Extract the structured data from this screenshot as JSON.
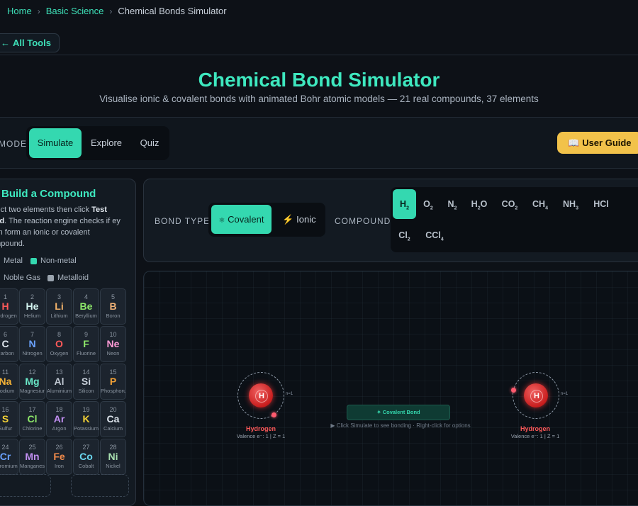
{
  "breadcrumb": {
    "home": "Home",
    "section": "Basic Science",
    "current": "Chemical Bonds Simulator",
    "sep": "›"
  },
  "back_button": {
    "label": "All Tools",
    "icon": "arrow-left-icon"
  },
  "header": {
    "title": "Chemical Bond Simulator",
    "subtitle": "Visualise ionic & covalent bonds with animated Bohr atomic models — 21 real compounds, 37 elements"
  },
  "mode": {
    "label": "MODE",
    "tabs": [
      {
        "label": "Simulate",
        "active": true
      },
      {
        "label": "Explore",
        "active": false
      },
      {
        "label": "Quiz",
        "active": false
      }
    ]
  },
  "user_guide": {
    "label": "User Guide",
    "icon": "book-icon"
  },
  "builder": {
    "title": "Build a Compound",
    "title_icon": "sparkle-icon",
    "desc_pre": "elect two elements then click ",
    "desc_bold1": "Test",
    "desc_bold2": "ond",
    "desc_post": ". The reaction engine checks if ey can form an ionic or covalent ompound.",
    "legend": [
      {
        "label": "Metal",
        "color": "#e0646a"
      },
      {
        "label": "Non-metal",
        "color": "#34d8b0"
      },
      {
        "label": "Noble Gas",
        "color": "#a77ee0"
      },
      {
        "label": "Metalloid",
        "color": "#9aa4ae"
      }
    ],
    "elements": [
      {
        "num": "1",
        "sym": "H",
        "name": "Hydrogen",
        "color": "#ff5a5a"
      },
      {
        "num": "2",
        "sym": "He",
        "name": "Helium",
        "color": "#d4f5f0"
      },
      {
        "num": "3",
        "sym": "Li",
        "name": "Lithium",
        "color": "#f4b36a"
      },
      {
        "num": "4",
        "sym": "Be",
        "name": "Beryllium",
        "color": "#8ee86a"
      },
      {
        "num": "5",
        "sym": "B",
        "name": "Boron",
        "color": "#f0b277"
      },
      {
        "num": "6",
        "sym": "C",
        "name": "Carbon",
        "color": "#dfe6ee"
      },
      {
        "num": "7",
        "sym": "N",
        "name": "Nitrogen",
        "color": "#6aa2ff"
      },
      {
        "num": "8",
        "sym": "O",
        "name": "Oxygen",
        "color": "#ff5a5a"
      },
      {
        "num": "9",
        "sym": "F",
        "name": "Fluorine",
        "color": "#8ee86a"
      },
      {
        "num": "10",
        "sym": "Ne",
        "name": "Neon",
        "color": "#ff9bd6"
      },
      {
        "num": "11",
        "sym": "Na",
        "name": "Sodium",
        "color": "#f4b236"
      },
      {
        "num": "12",
        "sym": "Mg",
        "name": "Magnesium",
        "color": "#6ae8c8"
      },
      {
        "num": "13",
        "sym": "Al",
        "name": "Aluminium",
        "color": "#c0c8d2"
      },
      {
        "num": "14",
        "sym": "Si",
        "name": "Silicon",
        "color": "#c8d0da"
      },
      {
        "num": "15",
        "sym": "P",
        "name": "Phosphorus",
        "color": "#f4a236"
      },
      {
        "num": "16",
        "sym": "S",
        "name": "Sulfur",
        "color": "#f4d236"
      },
      {
        "num": "17",
        "sym": "Cl",
        "name": "Chlorine",
        "color": "#8ee86a"
      },
      {
        "num": "18",
        "sym": "Ar",
        "name": "Argon",
        "color": "#c08ef0"
      },
      {
        "num": "19",
        "sym": "K",
        "name": "Potassium",
        "color": "#f4d236"
      },
      {
        "num": "20",
        "sym": "Ca",
        "name": "Calcium",
        "color": "#dfe6ee"
      },
      {
        "num": "24",
        "sym": "Cr",
        "name": "Chromium",
        "color": "#6aa2ff"
      },
      {
        "num": "25",
        "sym": "Mn",
        "name": "Manganese",
        "color": "#c08ef0"
      },
      {
        "num": "26",
        "sym": "Fe",
        "name": "Iron",
        "color": "#f08a4a"
      },
      {
        "num": "27",
        "sym": "Co",
        "name": "Cobalt",
        "color": "#6ad8f0"
      },
      {
        "num": "28",
        "sym": "Ni",
        "name": "Nickel",
        "color": "#a8e0b0"
      }
    ]
  },
  "controls": {
    "bond_type_label": "BOND TYPE",
    "bond_types": [
      {
        "label": "Covalent",
        "icon": "atom-icon",
        "active": true
      },
      {
        "label": "Ionic",
        "icon": "lightning-icon",
        "active": false
      }
    ],
    "compound_label": "COMPOUND",
    "compounds": [
      {
        "base": "H",
        "sub": "2",
        "tail": "",
        "active": true
      },
      {
        "base": "O",
        "sub": "2",
        "tail": "",
        "active": false
      },
      {
        "base": "N",
        "sub": "2",
        "tail": "",
        "active": false
      },
      {
        "base": "H",
        "sub": "2",
        "tail": "O",
        "active": false
      },
      {
        "base": "CO",
        "sub": "2",
        "tail": "",
        "active": false
      },
      {
        "base": "CH",
        "sub": "4",
        "tail": "",
        "active": false
      },
      {
        "base": "NH",
        "sub": "3",
        "tail": "",
        "active": false
      },
      {
        "base": "HCl",
        "sub": "",
        "tail": "",
        "active": false
      },
      {
        "base": "Cl",
        "sub": "2",
        "tail": "",
        "active": false
      },
      {
        "base": "CCl",
        "sub": "4",
        "tail": "",
        "active": false
      }
    ]
  },
  "canvas": {
    "bond_badge": "✦ Covalent Bond",
    "hint": "▶ Click Simulate to see bonding · Right-click for options",
    "atoms": [
      {
        "symbol": "H",
        "name": "Hydrogen",
        "info": "Valence e⁻: 1  |  Z = 1",
        "shell": "n=1",
        "color": "#ff5a5a"
      },
      {
        "symbol": "H",
        "name": "Hydrogen",
        "info": "Valence e⁻: 1  |  Z = 1",
        "shell": "n=1",
        "color": "#ff5a5a"
      }
    ]
  }
}
